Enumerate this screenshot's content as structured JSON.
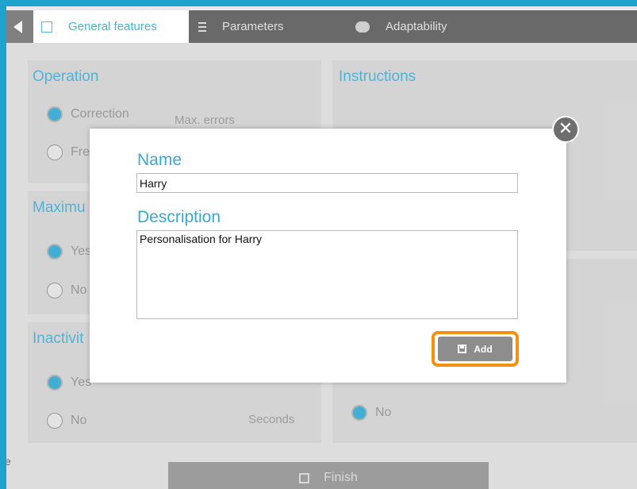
{
  "tabs": [
    {
      "label": "General features",
      "icon": "book-icon",
      "active": true
    },
    {
      "label": "Parameters",
      "icon": "list-icon",
      "active": false
    },
    {
      "label": "Adaptability",
      "icon": "adaptability-icon",
      "active": false
    }
  ],
  "panels": {
    "operation": {
      "title": "Operation",
      "options": [
        "Correction",
        "Fre"
      ],
      "selected": "Correction",
      "side_label": "Max. errors"
    },
    "instructions": {
      "title": "Instructions"
    },
    "maximum": {
      "title": "Maximu",
      "options": [
        "Yes",
        "No"
      ],
      "selected": "Yes"
    },
    "inactivity": {
      "title": "Inactivit",
      "options": [
        "Yes",
        "No"
      ],
      "selected": "Yes",
      "side_label": "Seconds"
    },
    "right_lower": {
      "options": [
        "No"
      ],
      "selected": "No"
    }
  },
  "finish_label": "Finish",
  "side_letters": "e",
  "modal": {
    "name_label": "Name",
    "name_value": "Harry",
    "description_label": "Description",
    "description_value": "Personalisation for Harry",
    "add_label": "Add",
    "close_symbol": "✕"
  },
  "colors": {
    "frame": "#1fa3cc",
    "accent": "#3aa8d3",
    "highlight": "#f39112",
    "button": "#8d8d8d"
  }
}
